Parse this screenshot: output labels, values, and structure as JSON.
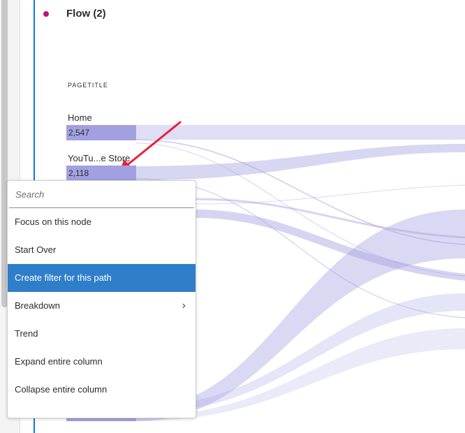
{
  "panel": {
    "title": "Flow (2)",
    "accent_color": "#1473e6",
    "dot_color": "#c2137b"
  },
  "column": {
    "header": "PAGETITLE"
  },
  "nodes": [
    {
      "label": "Home",
      "count": "2,547"
    },
    {
      "label": "YouTu...e Store",
      "count": "2,118"
    }
  ],
  "flow_color": "#a3a0e1",
  "annotation": {
    "arrow_color": "#e8203a"
  },
  "context_menu": {
    "search_placeholder": "Search",
    "items": [
      {
        "label": "Focus on this node",
        "selected": false
      },
      {
        "label": "Start Over",
        "selected": false
      },
      {
        "label": "Create filter for this path",
        "selected": true
      },
      {
        "label": "Breakdown",
        "selected": false,
        "submenu": true
      },
      {
        "label": "Trend",
        "selected": false
      },
      {
        "label": "Expand entire column",
        "selected": false
      },
      {
        "label": "Collapse entire column",
        "selected": false
      }
    ],
    "selected_color": "#2f7ec9",
    "submenu_icon": "chevron-right-icon"
  }
}
